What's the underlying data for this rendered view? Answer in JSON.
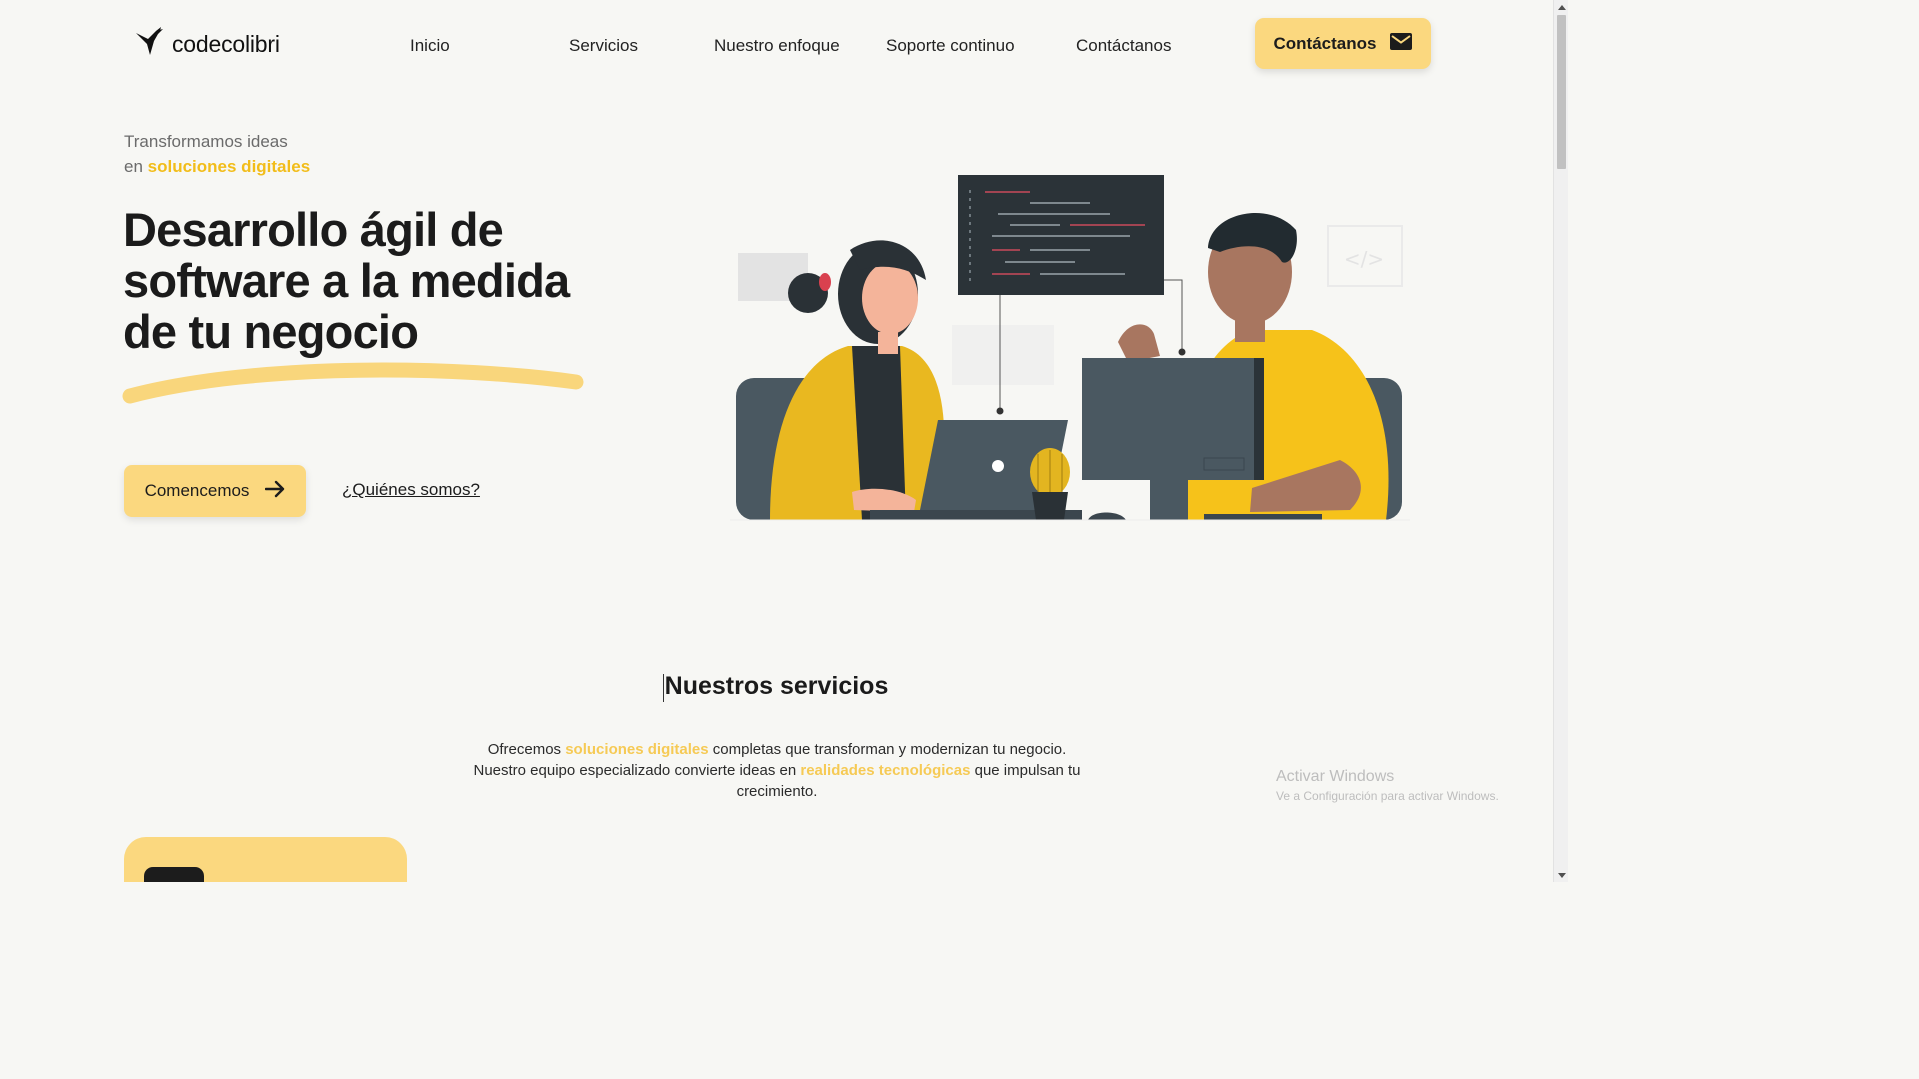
{
  "header": {
    "logo_text": "codecolibri",
    "nav": [
      "Inicio",
      "Servicios",
      "Nuestro enfoque",
      "Soporte continuo",
      "Contáctanos"
    ],
    "cta_label": "Contáctanos",
    "cta_icon": "envelope-icon"
  },
  "hero": {
    "eyebrow_line1": "Transformamos ideas",
    "eyebrow_prefix": "en",
    "eyebrow_highlight": "soluciones digitales",
    "title_line1": "Desarrollo ágil de",
    "title_line2": "software a la medida",
    "title_line3": "de tu negocio",
    "primary_button": "Comencemos",
    "primary_button_icon": "arrow-right-icon",
    "secondary_link": "¿Quiénes somos?"
  },
  "services": {
    "title": "Nuestros servicios",
    "desc_part1": "Ofrecemos ",
    "desc_hl1": "soluciones digitales",
    "desc_part2": " completas que transforman y modernizan tu negocio. Nuestro equipo especializado convierte ideas en ",
    "desc_hl2": "realidades tecnológicas",
    "desc_part3": " que impulsan tu crecimiento."
  },
  "watermark": {
    "title": "Activar Windows",
    "subtitle": "Ve a Configuración para activar Windows."
  },
  "colors": {
    "accent": "#fbd87f",
    "highlight": "#f2bd1a",
    "background": "#f7f7f4",
    "text": "#1b1b1b"
  }
}
